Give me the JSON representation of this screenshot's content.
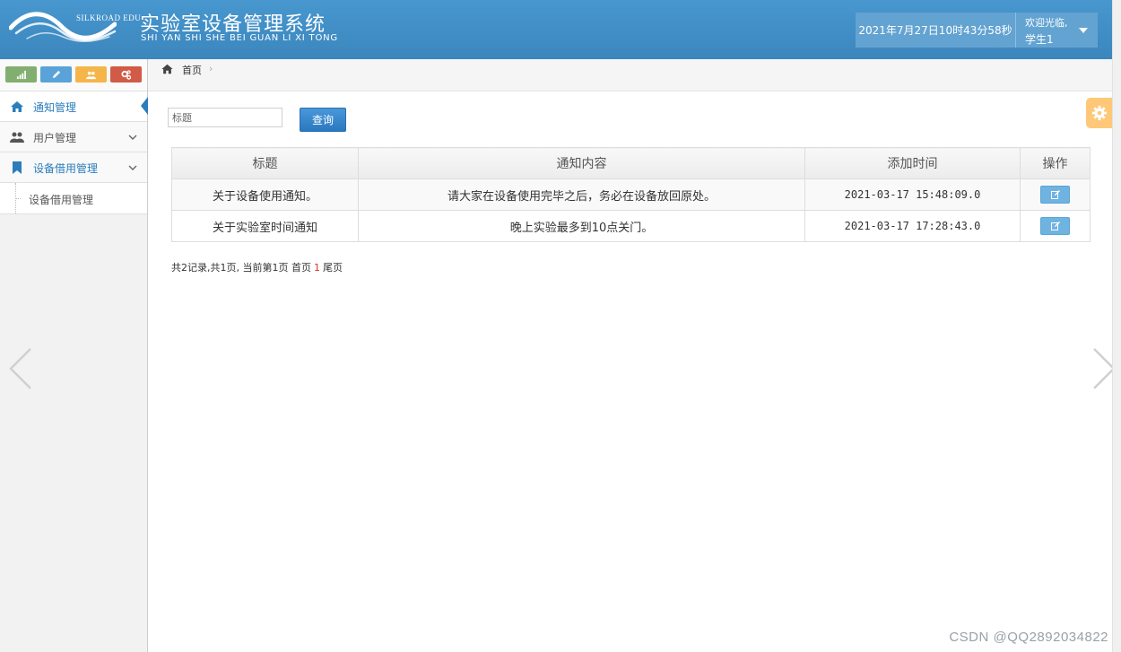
{
  "header": {
    "logo_text": "SILKROAD EDU",
    "title": "实验室设备管理系统",
    "subtitle": "SHI YAN SHI SHE BEI GUAN LI XI TONG",
    "datetime": "2021年7月27日10时43分58秒",
    "welcome": "欢迎光临,",
    "username": "学生1"
  },
  "sidebar": {
    "shortcuts": [
      "signal-icon",
      "pencil-icon",
      "users-icon",
      "cogs-icon"
    ],
    "items": [
      {
        "label": "通知管理",
        "icon": "home-icon",
        "active": true
      },
      {
        "label": "用户管理",
        "icon": "users-icon"
      },
      {
        "label": "设备借用管理",
        "icon": "bookmark-icon",
        "open": true
      }
    ],
    "sub_items": [
      {
        "label": "设备借用管理"
      }
    ]
  },
  "breadcrumb": {
    "home_label": "首页",
    "separator": "›"
  },
  "search": {
    "placeholder": "标题",
    "button_label": "查询"
  },
  "table": {
    "columns": [
      "标题",
      "通知内容",
      "添加时间",
      "操作"
    ],
    "rows": [
      {
        "title": "关于设备使用通知。",
        "content": "请大家在设备使用完毕之后，务必在设备放回原处。",
        "time": "2021-03-17 15:48:09.0"
      },
      {
        "title": "关于实验室时间通知",
        "content": "晚上实验最多到10点关门。",
        "time": "2021-03-17 17:28:43.0"
      }
    ]
  },
  "pager": {
    "summary": "共2记录,共1页, 当前第1页 首页",
    "current": "1",
    "last": "尾页"
  },
  "watermark": "CSDN @QQ2892034822",
  "colors": {
    "header": "#3f8fc7",
    "accent": "#2b7dbc",
    "button": "#3a8bd0",
    "settings": "#ffc878"
  }
}
